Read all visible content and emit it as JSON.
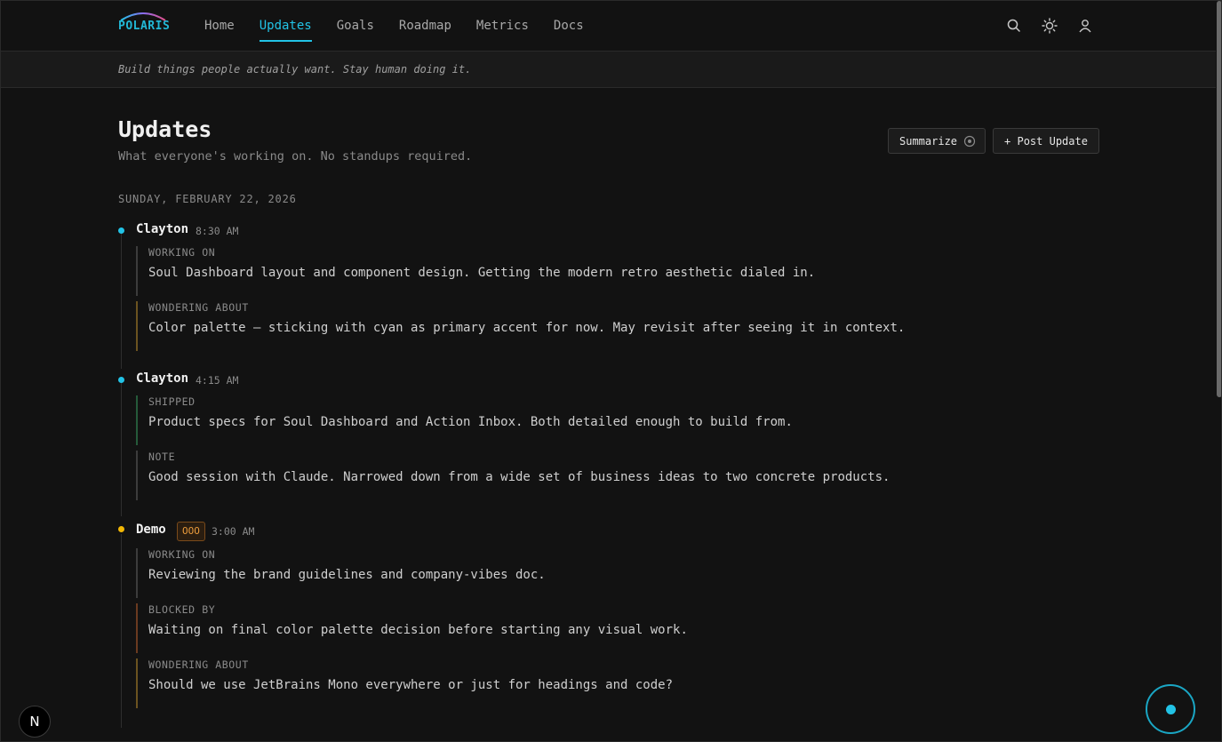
{
  "brand": {
    "logo_text": "POLARIS"
  },
  "nav": {
    "items": [
      {
        "label": "Home"
      },
      {
        "label": "Updates"
      },
      {
        "label": "Goals"
      },
      {
        "label": "Roadmap"
      },
      {
        "label": "Metrics"
      },
      {
        "label": "Docs"
      }
    ],
    "active": "Updates"
  },
  "header_icons": [
    "search-icon",
    "sun-icon",
    "user-icon"
  ],
  "tagline": "Build things people actually want. Stay human doing it.",
  "page": {
    "title": "Updates",
    "subtitle": "What everyone's working on. No standups required.",
    "summarize_label": "Summarize",
    "post_update_label": "+ Post Update"
  },
  "date_heading": "SUNDAY, FEBRUARY 22, 2026",
  "entries": [
    {
      "name": "Clayton",
      "time": "8:30 AM",
      "dot_color": "#22c3e6",
      "blocks": [
        {
          "label": "WORKING ON",
          "text": "Soul Dashboard layout and component design. Getting the modern retro aesthetic dialed in."
        },
        {
          "label": "WONDERING ABOUT",
          "text": "Color palette — sticking with cyan as primary accent for now. May revisit after seeing it in context."
        }
      ]
    },
    {
      "name": "Clayton",
      "time": "4:15 AM",
      "dot_color": "#22c3e6",
      "blocks": [
        {
          "label": "SHIPPED",
          "text": "Product specs for Soul Dashboard and Action Inbox. Both detailed enough to build from."
        },
        {
          "label": "NOTE",
          "text": "Good session with Claude. Narrowed down from a wide set of business ideas to two concrete products."
        }
      ]
    },
    {
      "name": "Demo",
      "badge": "OOO",
      "time": "3:00 AM",
      "dot_color": "#f2b705",
      "blocks": [
        {
          "label": "WORKING ON",
          "text": "Reviewing the brand guidelines and company-vibes doc."
        },
        {
          "label": "BLOCKED BY",
          "text": "Waiting on final color palette decision before starting any visual work."
        },
        {
          "label": "WONDERING ABOUT",
          "text": "Should we use JetBrains Mono everywhere or just for headings and code?"
        }
      ]
    }
  ],
  "floating": {
    "next_badge": "N"
  },
  "colors": {
    "accent": "#22c3e6",
    "warning": "#f2b705",
    "background": "#121212"
  }
}
